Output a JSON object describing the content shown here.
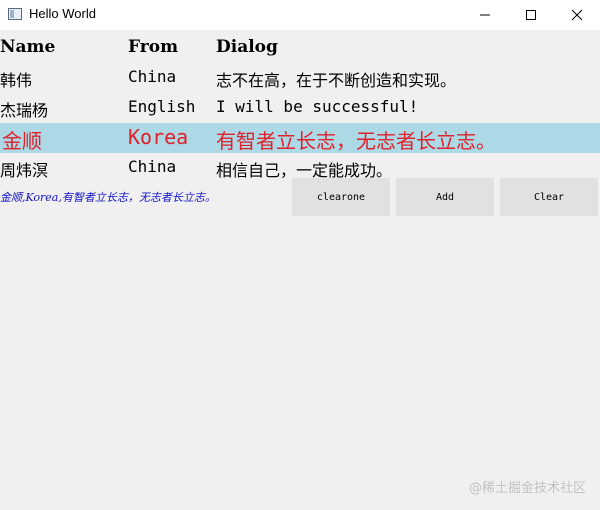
{
  "window": {
    "title": "Hello World",
    "icon": "window-app-icon",
    "controls": [
      "minimize-icon",
      "maximize-icon",
      "close-icon"
    ]
  },
  "table": {
    "headers": [
      "Name",
      "From",
      "Dialog"
    ],
    "rows": [
      {
        "name": "韩伟",
        "from": "China",
        "dialog": "志不在高，在于不断创造和实现。"
      },
      {
        "name": "杰瑞杨",
        "from": "English",
        "dialog": "I will be successful!"
      },
      {
        "name": "金顺",
        "from": "Korea",
        "dialog": "有智者立长志，无志者长立志。"
      },
      {
        "name": "周炜溟",
        "from": "China",
        "dialog": "相信自己，一定能成功。"
      }
    ],
    "selected_row": 2
  },
  "status_label": "金顺,Korea,有智者立长志，无志者长立志。",
  "buttons": {
    "clearone": "clearone",
    "add": "Add",
    "clear": "Clear"
  },
  "watermark": "@稀土掘金技术社区",
  "colors": {
    "selected_bg": "#add8e6",
    "selected_text": "#e0212a",
    "status_text": "#1010c8",
    "button_bg": "#e1e1e1"
  }
}
